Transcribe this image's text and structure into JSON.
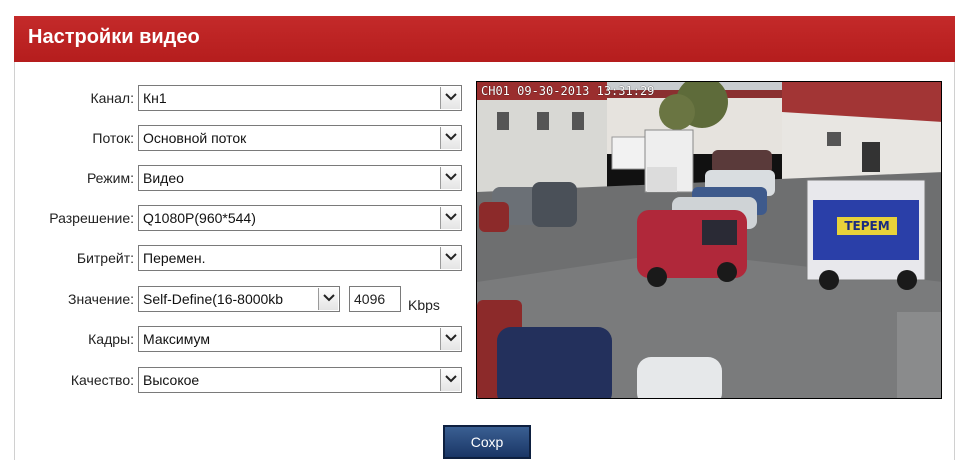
{
  "page": {
    "title": "Настройки видео"
  },
  "form": {
    "fields": [
      {
        "label": "Канал:",
        "value": "Кн1"
      },
      {
        "label": "Поток:",
        "value": "Основной поток"
      },
      {
        "label": "Режим:",
        "value": "Видео"
      },
      {
        "label": "Разрешение:",
        "value": "Q1080P(960*544)"
      },
      {
        "label": "Битрейт:",
        "value": "Перемен."
      },
      {
        "label": "Значение:",
        "value": "Self-Define(16-8000kb"
      },
      {
        "label": "Кадры:",
        "value": "Максимум"
      },
      {
        "label": "Качество:",
        "value": "Высокое"
      }
    ],
    "bitrate_value": "4096",
    "bitrate_unit": "Kbps",
    "save_label": "Сохр"
  },
  "preview": {
    "osd_text": "CH01  09-30-2013 13:31:29",
    "truck_sign": "ТЕРЕМ"
  },
  "colors": {
    "title_bar": "#b51d1d",
    "button": "#1f3d6e"
  }
}
